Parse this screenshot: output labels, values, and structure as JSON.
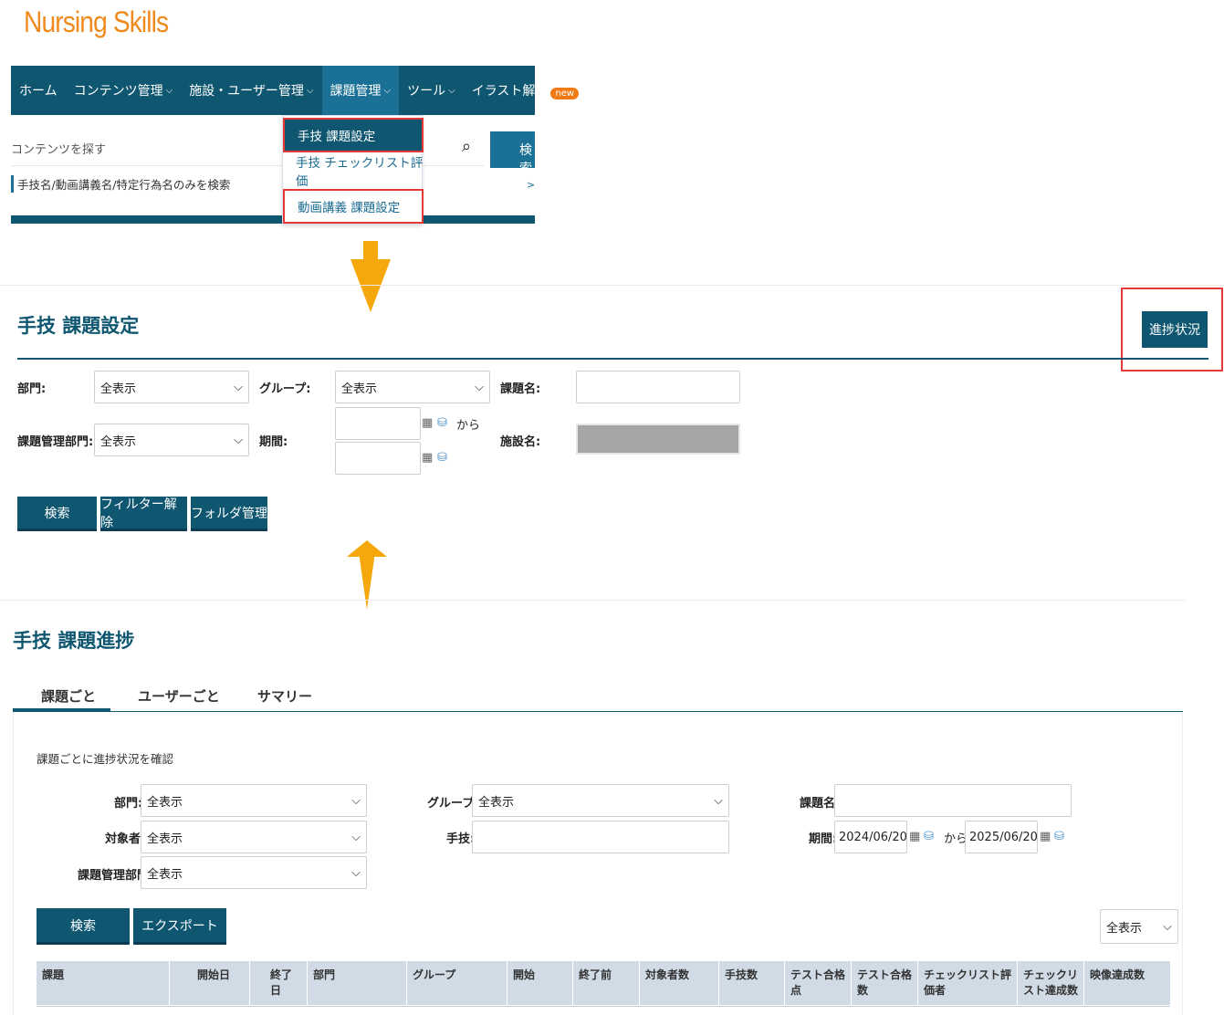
{
  "app": {
    "logo": "Nursing Skills"
  },
  "nav": {
    "items": [
      {
        "label": "ホーム",
        "chevron": ""
      },
      {
        "label": "コンテンツ管理",
        "chevron": "⌵"
      },
      {
        "label": "施設・ユーザー管理",
        "chevron": "⌵"
      },
      {
        "label": "課題管理",
        "chevron": "⌵"
      },
      {
        "label": "ツール",
        "chevron": "⌵"
      },
      {
        "label": "イラスト解説",
        "chevron": ""
      }
    ],
    "new_badge": "new",
    "search_placeholder": "コンテンツを探す",
    "search_button": "検索",
    "filter_text": "手技名/動画講義名/特定行為名のみを検索",
    "dropdown": [
      "手技 課題設定",
      "手技 チェックリスト評価",
      "動画講義 課題設定"
    ]
  },
  "settings_panel": {
    "title": "手技 課題設定",
    "progress_button": "進捗状況",
    "labels": {
      "department": "部門:",
      "group": "グループ:",
      "task_name": "課題名:",
      "mgmt_department": "課題管理部門:",
      "period": "期間:",
      "facility": "施設名:",
      "from": "から"
    },
    "select_all": "全表示",
    "buttons": {
      "search": "検索",
      "clear": "フィルター解除",
      "folder": "フォルダ管理"
    }
  },
  "progress_panel": {
    "title": "手技 課題進捗",
    "tabs": [
      "課題ごと",
      "ユーザーごと",
      "サマリー"
    ],
    "description": "課題ごとに進捗状況を確認",
    "labels": {
      "department": "部門:",
      "target": "対象者:",
      "mgmt_department": "課題管理部門:",
      "group": "グループ:",
      "skill": "手技:",
      "task_name": "課題名:",
      "period": "期間:",
      "from": "から"
    },
    "select_all": "全表示",
    "period_start": "2024/06/20",
    "period_end": "2025/06/20",
    "buttons": {
      "search": "検索",
      "export": "エクスポート"
    },
    "page_size": "全表示",
    "columns": [
      "課題",
      "開始日",
      "終了日",
      "部門",
      "グループ",
      "開始",
      "終了前",
      "対象者数",
      "手技数",
      "テスト合格点",
      "テスト合格数",
      "チェックリスト評価者",
      "チェックリスト達成数",
      "映像達成数"
    ]
  },
  "colors": {
    "brand": "#0f5670",
    "accent": "#f08a1c",
    "highlight": "#e53935",
    "arrow": "#f5a70b"
  }
}
